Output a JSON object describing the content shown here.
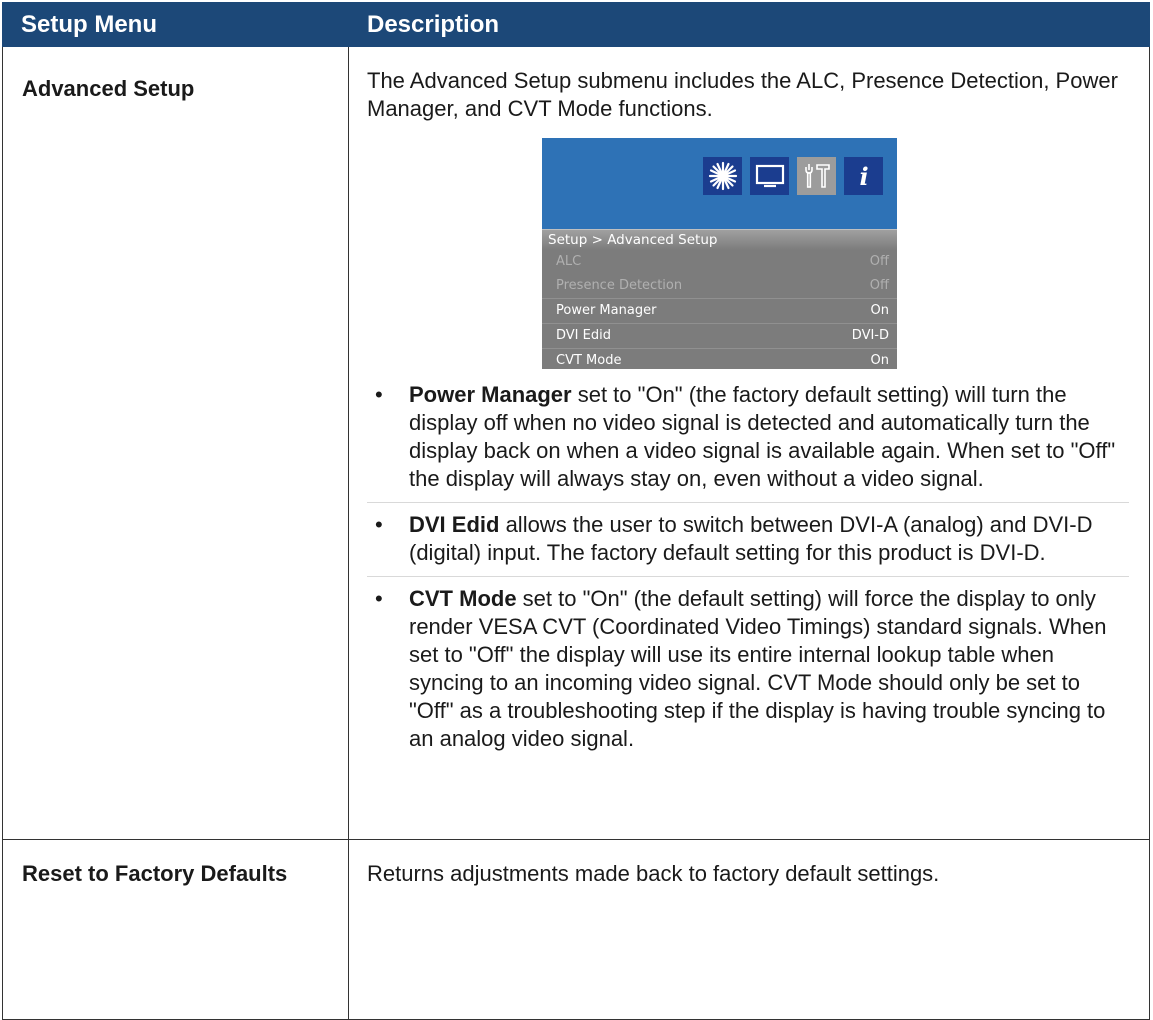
{
  "header": {
    "col1": "Setup Menu",
    "col2": "Description"
  },
  "rows": [
    {
      "menu": "Advanced Setup",
      "intro": "The Advanced Setup submenu includes the ALC, Presence Detection, Power Manager, and CVT Mode functions.",
      "osd": {
        "breadcrumb": "Setup > Advanced Setup",
        "icons": [
          "brightness-icon",
          "display-icon",
          "tools-icon",
          "info-icon"
        ],
        "items": [
          {
            "label": "ALC",
            "value": "Off"
          },
          {
            "label": "Presence Detection",
            "value": "Off"
          },
          {
            "label": "Power Manager",
            "value": "On"
          },
          {
            "label": "DVI Edid",
            "value": "DVI-D"
          },
          {
            "label": "CVT Mode",
            "value": "On"
          }
        ],
        "colors": {
          "top": "#2e72b6",
          "icon": "#1b3d8f",
          "body": "#7c7c7c"
        }
      },
      "bullets": [
        {
          "lead": "Power Manager",
          "text": " set to \"On\" (the factory default setting) will turn the display off when no video signal is detected and automatically turn the display back on when a video signal is available again.  When set to \"Off\" the display will always stay on, even without a video signal."
        },
        {
          "lead": "DVI Edid",
          "text": " allows the user to switch between DVI-A (analog) and DVI-D (digital) input. The factory default setting for this product is DVI-D."
        },
        {
          "lead": "CVT Mode",
          "text": " set to \"On\" (the default setting) will force the display to only render VESA CVT (Coordinated Video Timings) standard signals.  When set to \"Off\" the display will use its entire internal lookup table when syncing to an incoming video signal.  CVT Mode should only be set to \"Off\" as a troubleshooting step if the display is having trouble syncing to an analog video signal."
        }
      ]
    },
    {
      "menu": "Reset to Factory Defaults",
      "description": "Returns adjustments made back to factory default settings."
    }
  ],
  "bullet_glyph": "•",
  "header_color": "#1c4878"
}
